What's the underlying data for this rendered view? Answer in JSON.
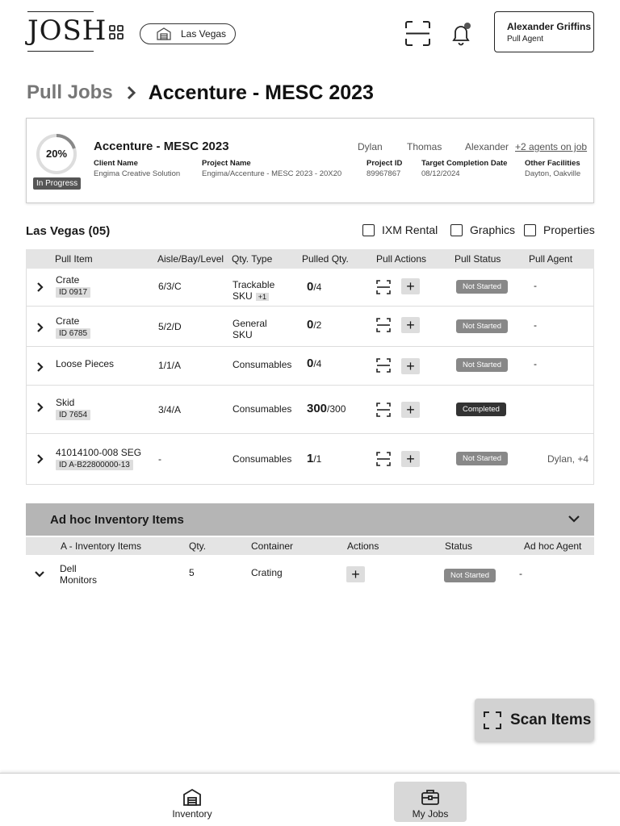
{
  "header": {
    "logo": "JOSH",
    "location": "Las Vegas",
    "user": {
      "name": "Alexander Griffins",
      "role": "Pull Agent"
    }
  },
  "breadcrumb": {
    "parent": "Pull Jobs",
    "current": "Accenture - MESC 2023"
  },
  "job": {
    "progress_text": "20%",
    "progress_fraction": 0.2,
    "status": "In Progress",
    "title": "Accenture - MESC 2023",
    "agents": [
      "Dylan",
      "Thomas",
      "Alexander"
    ],
    "more_agents": "+2 agents on job",
    "meta": [
      {
        "label": "Client Name",
        "value": "Engima Creative Solution"
      },
      {
        "label": "Project Name",
        "value": "Engima/Accenture - MESC 2023 - 20X20"
      },
      {
        "label": "Project ID",
        "value": "89967867"
      },
      {
        "label": "Target Completion Date",
        "value": "08/12/2024"
      },
      {
        "label": "Other Facilities",
        "value": "Dayton, Oakville"
      }
    ]
  },
  "section": {
    "title": "Las Vegas (05)",
    "filters": [
      "IXM Rental",
      "Graphics",
      "Properties"
    ]
  },
  "table": {
    "columns": [
      "Pull Item",
      "Aisle/Bay/Level",
      "Qty. Type",
      "Pulled Qty.",
      "Pull Actions",
      "Pull Status",
      "Pull Agent"
    ],
    "rows": [
      {
        "item": "Crate",
        "id": "ID 0917",
        "location": "6/3/C",
        "qty_type_1": "Trackable",
        "qty_type_2": "SKU",
        "extra": "+1",
        "pulled": "0",
        "total": "/4",
        "status": "Not Started",
        "agent": "-"
      },
      {
        "item": "Crate",
        "id": "ID 6785",
        "location": "5/2/D",
        "qty_type_1": "General",
        "qty_type_2": "SKU",
        "extra": "",
        "pulled": "0",
        "total": "/2",
        "status": "Not Started",
        "agent": "-"
      },
      {
        "item": "Loose Pieces",
        "id": "",
        "location": "1/1/A",
        "qty_type_1": "Consumables",
        "qty_type_2": "",
        "extra": "",
        "pulled": "0",
        "total": "/4",
        "status": "Not Started",
        "agent": "-"
      },
      {
        "item": "Skid",
        "id": "ID 7654",
        "location": "3/4/A",
        "qty_type_1": "Consumables",
        "qty_type_2": "",
        "extra": "",
        "pulled": "300",
        "total": "/300",
        "status": "Completed",
        "agent": ""
      },
      {
        "item": "41014100-008 SEG",
        "id": "ID A-B22800000-13",
        "location": "-",
        "qty_type_1": "Consumables",
        "qty_type_2": "",
        "extra": "",
        "pulled": "1",
        "total": "/1",
        "status": "Not Started",
        "agent": "Dylan, +4"
      }
    ]
  },
  "adhoc": {
    "title": "Ad hoc Inventory Items",
    "columns": [
      "A - Inventory Items",
      "Qty.",
      "Container",
      "Actions",
      "Status",
      "Ad hoc Agent"
    ],
    "row": {
      "item_1": "Dell",
      "item_2": "Monitors",
      "qty": "5",
      "container": "Crating",
      "status": "Not Started",
      "agent": "-"
    }
  },
  "scan_button": "Scan Items",
  "nav": {
    "inventory": "Inventory",
    "my_jobs": "My Jobs"
  }
}
